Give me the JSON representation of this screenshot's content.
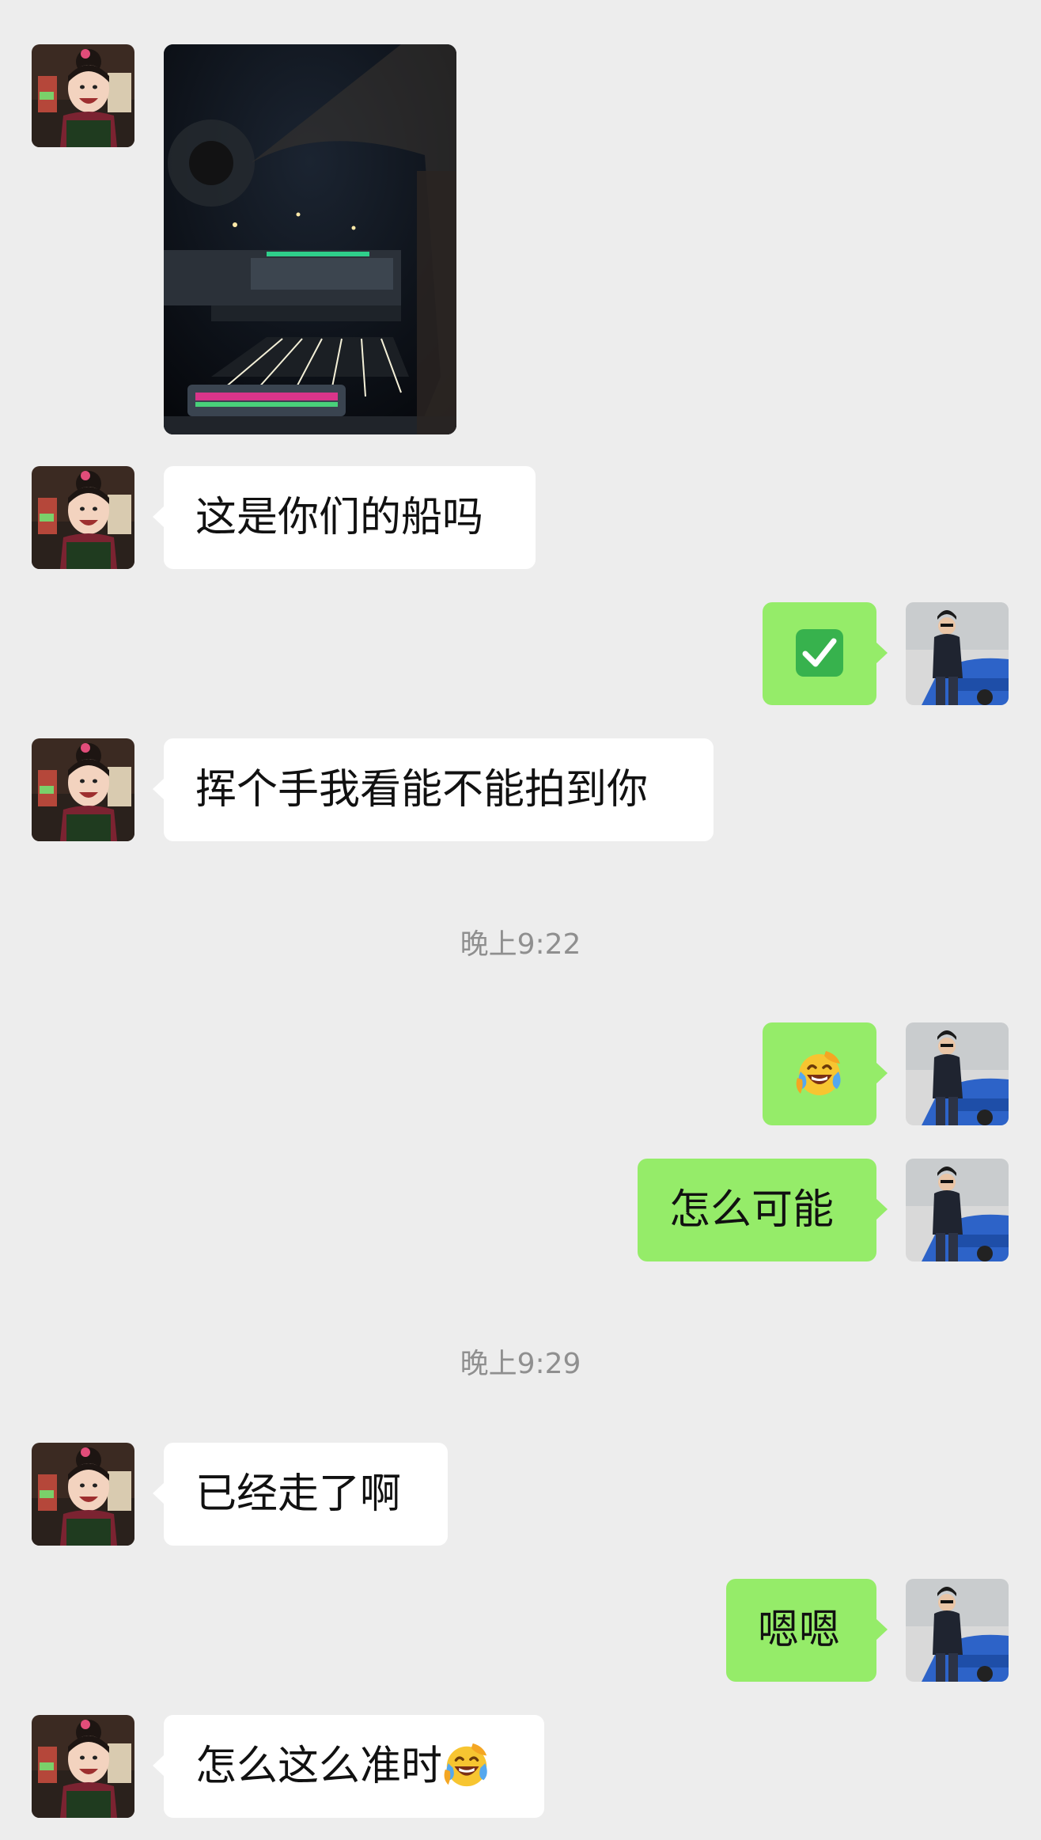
{
  "messages": [
    {
      "id": "m1",
      "side": "in",
      "type": "video"
    },
    {
      "id": "m2",
      "side": "in",
      "type": "text",
      "text": "这是你们的船吗"
    },
    {
      "id": "m3",
      "side": "out",
      "type": "emoji",
      "emoji": "✅",
      "icon": "check-mark-button"
    },
    {
      "id": "m4",
      "side": "in",
      "type": "text",
      "text": "挥个手我看能不能拍到你"
    },
    {
      "id": "t1",
      "type": "timestamp",
      "text": "晚上9:22"
    },
    {
      "id": "m5",
      "side": "out",
      "type": "emoji",
      "icon": "laughing-crying-face"
    },
    {
      "id": "m6",
      "side": "out",
      "type": "text",
      "text": "怎么可能"
    },
    {
      "id": "t2",
      "type": "timestamp",
      "text": "晚上9:29"
    },
    {
      "id": "m7",
      "side": "in",
      "type": "text",
      "text": "已经走了啊"
    },
    {
      "id": "m8",
      "side": "out",
      "type": "text",
      "text": "嗯嗯"
    },
    {
      "id": "m9",
      "side": "in",
      "type": "text",
      "text": "怎么这么准时",
      "trailing_icon": "laughing-crying-face"
    }
  ],
  "colors": {
    "background": "#ededed",
    "incoming_bubble": "#ffffff",
    "outgoing_bubble": "#95ec69",
    "timestamp_text": "#8f8f8f",
    "check_green": "#37b24d"
  }
}
